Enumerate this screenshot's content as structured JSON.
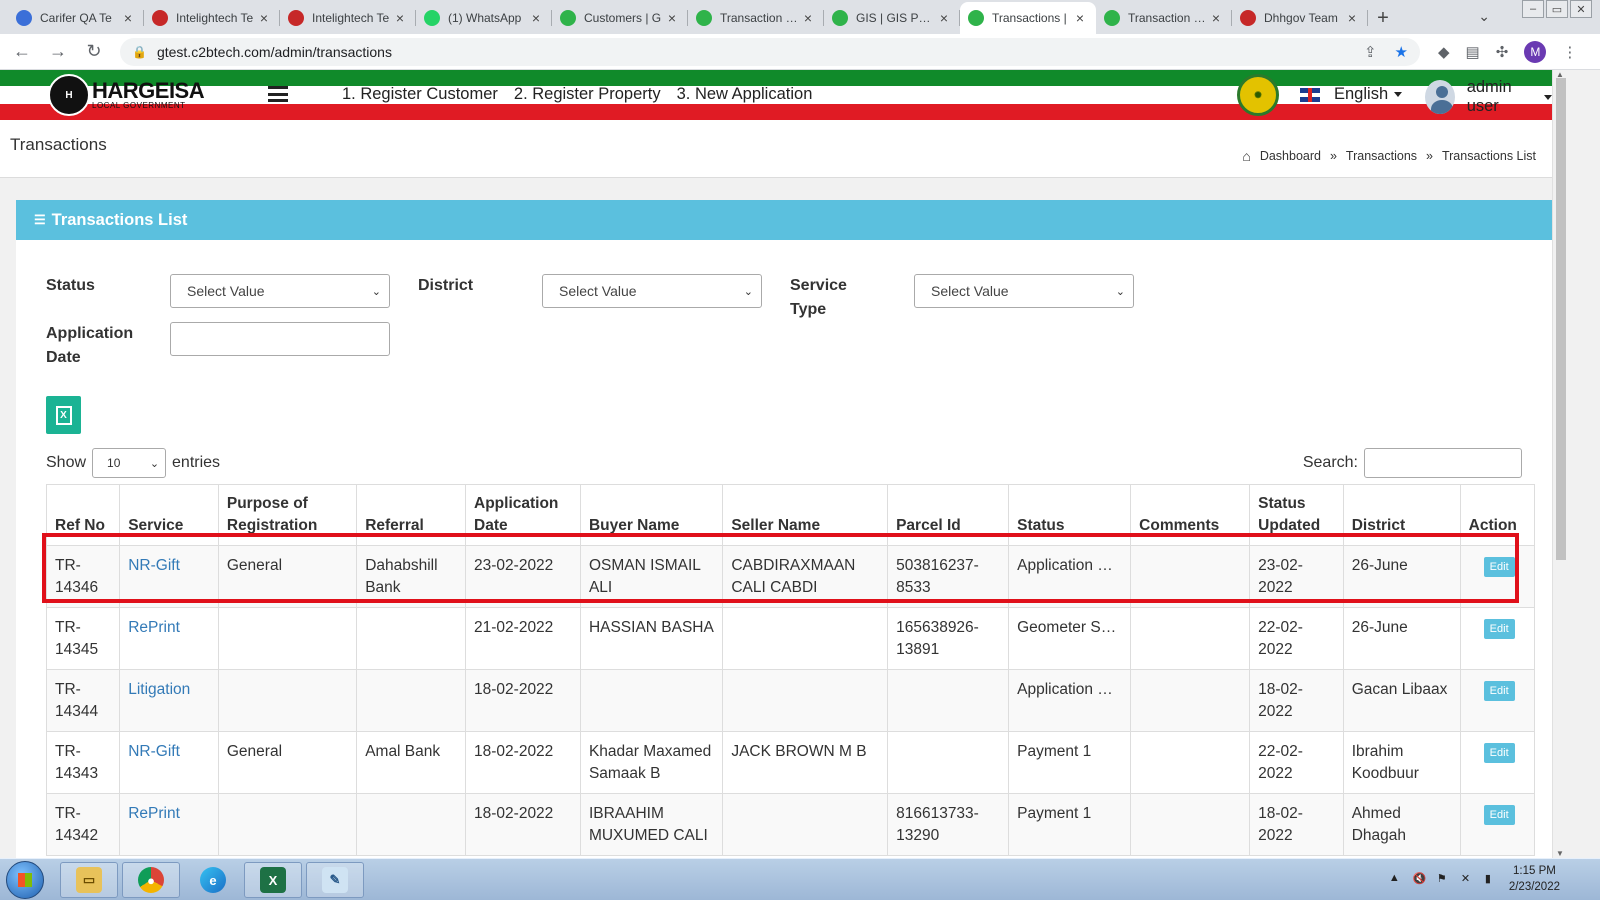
{
  "browser": {
    "tabs": [
      {
        "title": "Carifer QA Te",
        "favicon_color": "#3b6fd8",
        "active": false
      },
      {
        "title": "Intelightech Te",
        "favicon_color": "#c62828",
        "active": false
      },
      {
        "title": "Intelightech Te",
        "favicon_color": "#c62828",
        "active": false
      },
      {
        "title": "(1) WhatsApp",
        "favicon_color": "#25d366",
        "active": false
      },
      {
        "title": "Customers | G",
        "favicon_color": "#2fb34a",
        "active": false
      },
      {
        "title": "Transaction | G",
        "favicon_color": "#2fb34a",
        "active": false
      },
      {
        "title": "GIS | GIS Porta",
        "favicon_color": "#2fb34a",
        "active": false
      },
      {
        "title": "Transactions |",
        "favicon_color": "#2fb34a",
        "active": true
      },
      {
        "title": "Transaction | G",
        "favicon_color": "#2fb34a",
        "active": false
      },
      {
        "title": "Dhhgov Team",
        "favicon_color": "#c62828",
        "active": false
      }
    ],
    "url": "gtest.c2btech.com/admin/transactions",
    "profile_initial": "M"
  },
  "app": {
    "logo_name": "HARGEISA",
    "logo_sub": "LOCAL GOVERNMENT",
    "menu": [
      "1. Register Customer",
      "2. Register Property",
      "3. New Application"
    ],
    "language": "English",
    "user": "admin user",
    "colors": {
      "green": "#108a2a",
      "red": "#e01b24",
      "accent": "#5bc0de",
      "link": "#337ab7"
    }
  },
  "page": {
    "title": "Transactions",
    "breadcrumbs": [
      "Dashboard",
      "Transactions",
      "Transactions List"
    ],
    "breadcrumb_sep": "»"
  },
  "card": {
    "title": "Transactions List",
    "filters": {
      "status_label": "Status",
      "status_value": "Select Value",
      "district_label": "District",
      "district_value": "Select Value",
      "service_type_label": "Service Type",
      "service_type_value": "Select Value",
      "application_date_label": "Application Date",
      "application_date_value": ""
    },
    "show_label": "Show",
    "entries_value": "10",
    "entries_label": "entries",
    "search_label": "Search:"
  },
  "table": {
    "columns": [
      "Ref No",
      "Service",
      "Purpose of Registration",
      "Referral",
      "Application Date",
      "Buyer Name",
      "Seller Name",
      "Parcel Id",
      "Status",
      "Comments",
      "Status Updated",
      "District",
      "Action"
    ],
    "rows": [
      {
        "ref": "TR-14346",
        "service": "NR-Gift",
        "purpose": "General",
        "referral": "Dahabshill Bank",
        "app_date": "23-02-2022",
        "buyer": "OSMAN ISMAIL ALI",
        "seller": "CABDIRAXMAAN CALI CABDI",
        "parcel": "503816237-8533",
        "status": "Application Submitted",
        "comments": "",
        "updated": "23-02-2022",
        "district": "26-June",
        "action": "Edit"
      },
      {
        "ref": "TR-14345",
        "service": "RePrint",
        "purpose": "",
        "referral": "",
        "app_date": "21-02-2022",
        "buyer": "HASSIAN BASHA",
        "seller": "",
        "parcel": "165638926-13891",
        "status": "Geometer Survey",
        "comments": "",
        "updated": "22-02-2022",
        "district": "26-June",
        "action": "Edit"
      },
      {
        "ref": "TR-14344",
        "service": "Litigation",
        "purpose": "",
        "referral": "",
        "app_date": "18-02-2022",
        "buyer": "",
        "seller": "",
        "parcel": "",
        "status": "Application Submitted",
        "comments": "",
        "updated": "18-02-2022",
        "district": "Gacan Libaax",
        "action": "Edit"
      },
      {
        "ref": "TR-14343",
        "service": "NR-Gift",
        "purpose": "General",
        "referral": "Amal Bank",
        "app_date": "18-02-2022",
        "buyer": "Khadar Maxamed Samaak B",
        "seller": "JACK BROWN M B",
        "parcel": "",
        "status": "Payment 1",
        "comments": "",
        "updated": "22-02-2022",
        "district": "Ibrahim Koodbuur",
        "action": "Edit"
      },
      {
        "ref": "TR-14342",
        "service": "RePrint",
        "purpose": "",
        "referral": "",
        "app_date": "18-02-2022",
        "buyer": "IBRAAHIM MUXUMED CALI",
        "seller": "",
        "parcel": "816613733-13290",
        "status": "Payment 1",
        "comments": "",
        "updated": "18-02-2022",
        "district": "Ahmed Dhagah",
        "action": "Edit"
      }
    ]
  },
  "taskbar": {
    "time": "1:15 PM",
    "date": "2/23/2022"
  }
}
